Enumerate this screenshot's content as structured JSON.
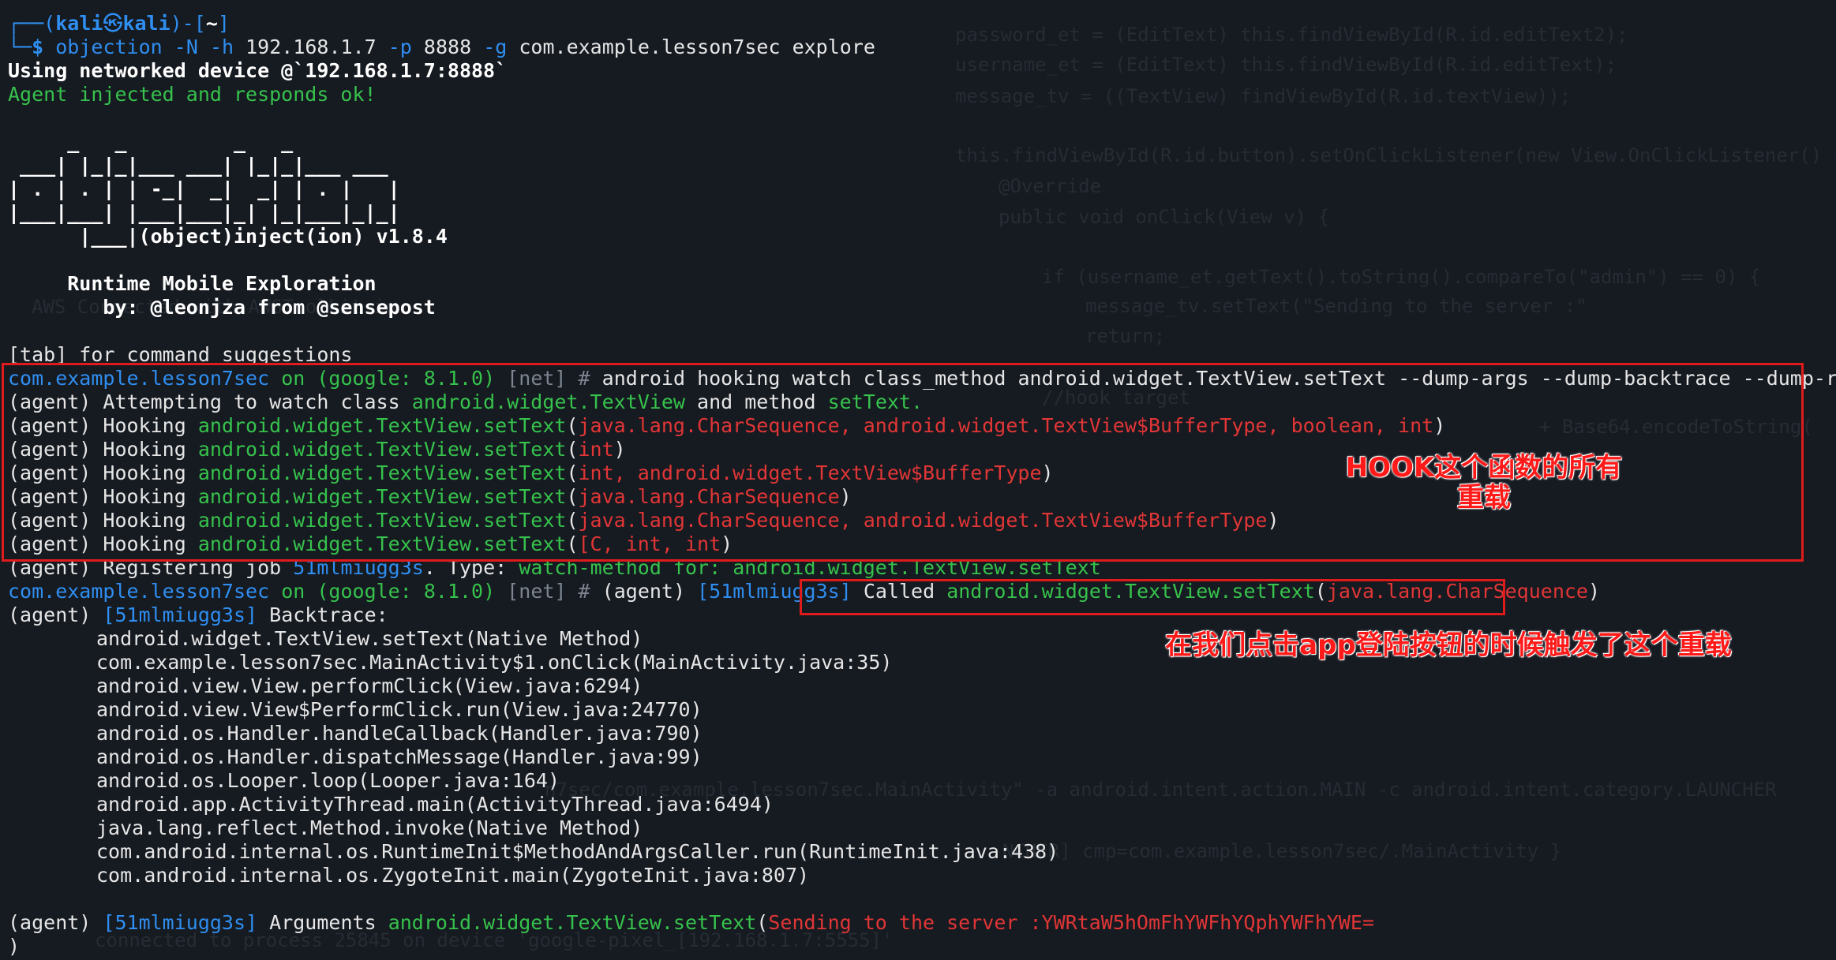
{
  "background_code": [
    "password_et = (EditText) this.findViewById(R.id.editText2);",
    "username_et = (EditText) this.findViewById(R.id.editText);",
    "message_tv = ((TextView) findViewById(R.id.textView));",
    "this.findViewById(R.id.button).setOnClickListener(new View.OnClickListener() {",
    "@Override",
    "public void onClick(View v) {",
    "if (username_et.getText().toString().compareTo(\"admin\") == 0) {",
    "message_tv.setText(\"Sending to the server :\"",
    "return;",
    "//hook target",
    "+ Base64.encodeToString(",
    "AWS Connected with AWSToolkit.io",
    "n7sec/com.example.lesson7sec.MainActivity\" -a android.intent.action.MAIN -c android.intent.category.LAUNCHER",
    "NCHER] cmp=com.example.lesson7sec/.MainActivity }",
    "connected to process 25845 on device 'google-pixel_[192.168.1.7:5555]'"
  ],
  "prompt": {
    "user": "kali",
    "host": "kali",
    "cwd": "~",
    "symbol": "㉿",
    "dollar": "$"
  },
  "command": {
    "name": "objection",
    "flag_n": "-N",
    "flag_h": "-h",
    "host": "192.168.1.7",
    "flag_p": "-p",
    "port": "8888",
    "flag_g": "-g",
    "package": "com.example.lesson7sec",
    "action": "explore"
  },
  "output": {
    "networked": "Using networked device @`192.168.1.7:8888`",
    "injected": "Agent injected and responds ok!",
    "logo": [
      "     _   _         _   _",
      " ___| |_|_|___ ___| |_|_|___ ___",
      "| . | . | | -_|  _|  _| | . |   |",
      "|___|___| |___|___|_| |_|___|_|_|",
      "      |___|(object)inject(ion) v1.8.4"
    ],
    "runtime": "     Runtime Mobile Exploration",
    "by": "        by: @leonjza from @sensepost",
    "tab_hint": "[tab] for command suggestions"
  },
  "session": {
    "package": "com.example.lesson7sec",
    "on": "on",
    "device": "(google: 8.1.0)",
    "net": "[net]",
    "hash": "#"
  },
  "hook_cmd": "android hooking watch class_method android.widget.TextView.setText --dump-args --dump-backtrace --dump-return",
  "agent": "(agent)",
  "attempt": {
    "prefix": "Attempting to watch class",
    "cls": "android.widget.TextView",
    "mid": "and method",
    "method": "setText."
  },
  "hooking_word": "Hooking",
  "hook_method": "android.widget.TextView.setText",
  "overloads": [
    "java.lang.CharSequence, android.widget.TextView$BufferType, boolean, int",
    "int",
    "int, android.widget.TextView$BufferType",
    "java.lang.CharSequence",
    "java.lang.CharSequence, android.widget.TextView$BufferType",
    "[C, int, int"
  ],
  "register": {
    "prefix": "Registering job",
    "job": "51mlmiugg3s",
    "type_label": ". Type:",
    "type": "watch-method for: android.widget.TextView.setText"
  },
  "called": {
    "job": "[51mlmiugg3s]",
    "word": "Called",
    "method": "android.widget.TextView.setText",
    "arg": "java.lang.CharSequence"
  },
  "backtrace_label": "Backtrace:",
  "backtrace": [
    "android.widget.TextView.setText(Native Method)",
    "com.example.lesson7sec.MainActivity$1.onClick(MainActivity.java:35)",
    "android.view.View.performClick(View.java:6294)",
    "android.view.View$PerformClick.run(View.java:24770)",
    "android.os.Handler.handleCallback(Handler.java:790)",
    "android.os.Handler.dispatchMessage(Handler.java:99)",
    "android.os.Looper.loop(Looper.java:164)",
    "android.app.ActivityThread.main(ActivityThread.java:6494)",
    "java.lang.reflect.Method.invoke(Native Method)",
    "com.android.internal.os.RuntimeInit$MethodAndArgsCaller.run(RuntimeInit.java:438)",
    "com.android.internal.os.ZygoteInit.main(ZygoteInit.java:807)"
  ],
  "arguments": {
    "label": "Arguments",
    "method": "android.widget.TextView.setText",
    "value": "Sending to the server :YWRtaW5hOmFhYWFhYQphYWFhYWE=",
    "close": ")"
  },
  "annotations": {
    "hook_all_line1": "HOOK这个函数的所有",
    "hook_all_line2": "重载",
    "triggered": "在我们点击app登陆按钮的时候触发了这个重载"
  },
  "colors": {
    "background": "#161a21",
    "blue": "#2f8ef0",
    "green": "#36c24c",
    "red_text": "#e13636",
    "box": "#e01b1b"
  }
}
